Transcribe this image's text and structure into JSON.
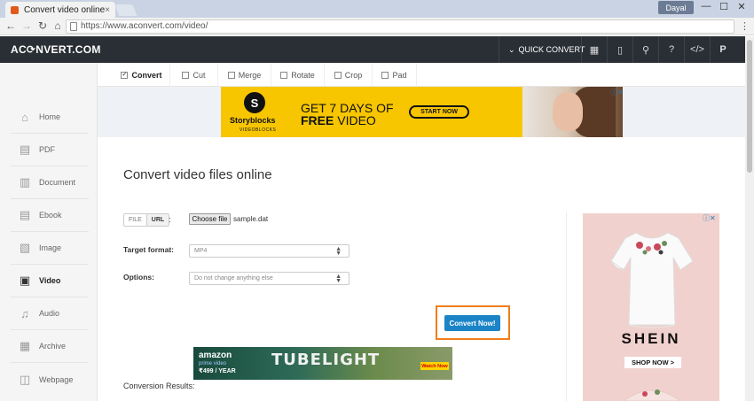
{
  "browser": {
    "tab_title": "Convert video online",
    "tab_close": "×",
    "profile_label": "Dayal",
    "url": "https://www.aconvert.com/video/",
    "window_min": "—",
    "window_max": "☐",
    "window_close": "✕"
  },
  "header": {
    "logo": "AC⟳NVERT.COM",
    "quick_convert": "QUICK CONVERT"
  },
  "sidebar": {
    "items": [
      {
        "label": "Home",
        "icon": "home-icon"
      },
      {
        "label": "PDF",
        "icon": "pdf-icon"
      },
      {
        "label": "Document",
        "icon": "document-icon"
      },
      {
        "label": "Ebook",
        "icon": "ebook-icon"
      },
      {
        "label": "Image",
        "icon": "image-icon"
      },
      {
        "label": "Video",
        "icon": "video-icon"
      },
      {
        "label": "Audio",
        "icon": "audio-icon"
      },
      {
        "label": "Archive",
        "icon": "archive-icon"
      },
      {
        "label": "Webpage",
        "icon": "webpage-icon"
      }
    ],
    "active": "Video"
  },
  "tabs": [
    {
      "label": "Convert",
      "checked": true
    },
    {
      "label": "Cut",
      "checked": false
    },
    {
      "label": "Merge",
      "checked": false
    },
    {
      "label": "Rotate",
      "checked": false
    },
    {
      "label": "Crop",
      "checked": false
    },
    {
      "label": "Pad",
      "checked": false
    }
  ],
  "banner_ad": {
    "brand": "Storyblocks",
    "brand_sub": "VIDEOBLOCKS",
    "line1": "GET 7 DAYS OF",
    "line2_bold": "FREE",
    "line2_rest": " VIDEO",
    "cta": "START NOW"
  },
  "main": {
    "title": "Convert video files online",
    "source_file": "FILE",
    "source_url": "URL",
    "colon": ":",
    "choose_file": "Choose file",
    "file_name": "sample.dat",
    "target_label": "Target format:",
    "target_value": "MP4",
    "options_label": "Options:",
    "options_value": "Do not change anything else",
    "convert_button": "Convert Now!",
    "results_label": "Conversion Results:"
  },
  "bottom_ad": {
    "brand": "amazon",
    "sub": "prime video",
    "price": "₹499 / YEAR",
    "title": "TUBELIGHT",
    "cta": "Watch Now"
  },
  "side_ad": {
    "brand": "SHEIN",
    "cta": "SHOP NOW >"
  },
  "colors": {
    "header_bg": "#2a2f35",
    "accent_blue": "#1a84c6",
    "highlight_orange": "#f07d1a",
    "ad_yellow": "#f7c600"
  }
}
